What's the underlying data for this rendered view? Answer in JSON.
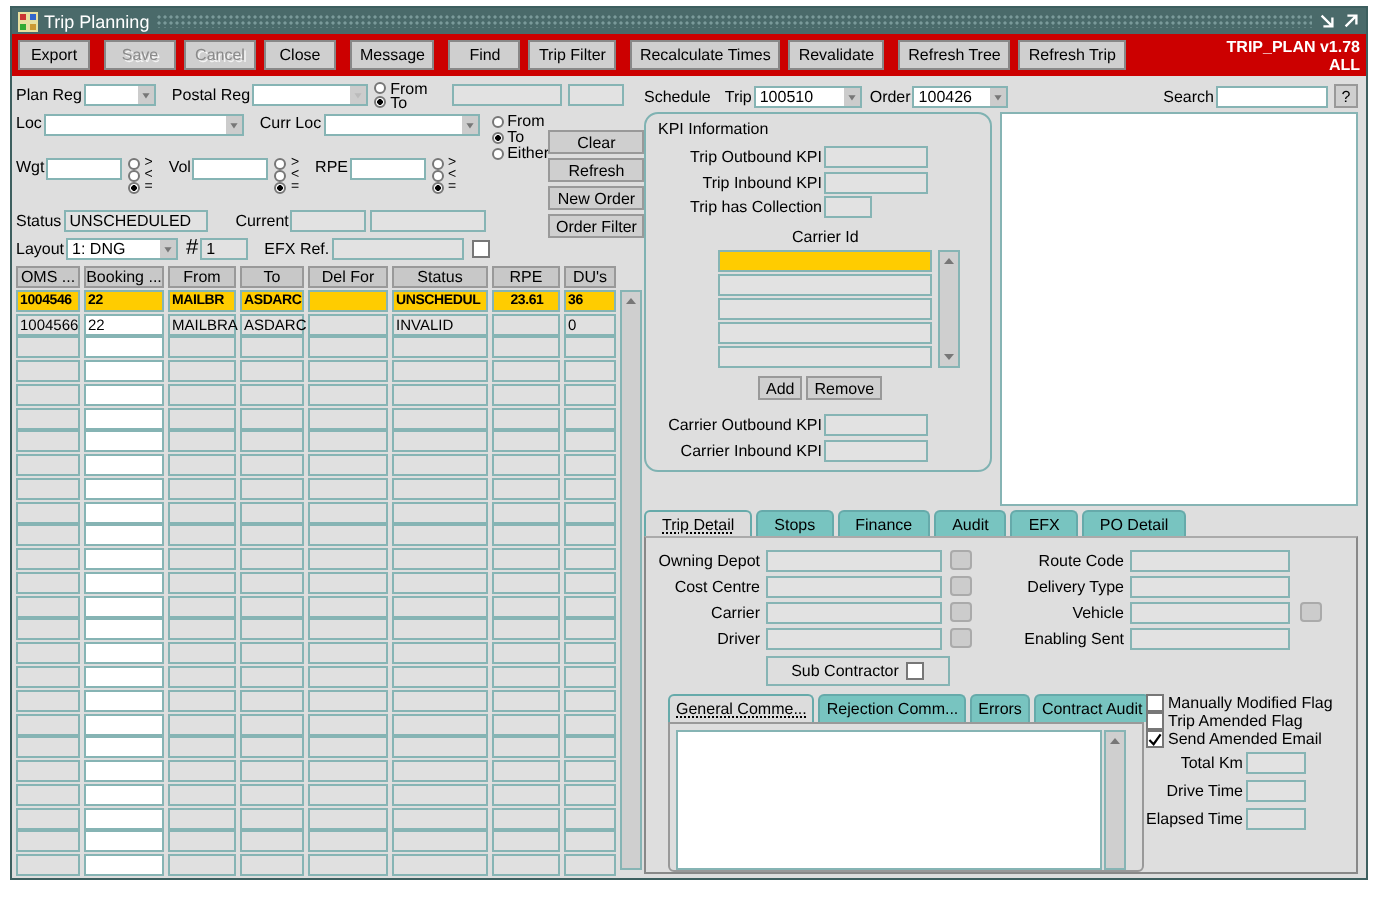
{
  "window": {
    "title": "Trip Planning",
    "version": "TRIP_PLAN v1.78",
    "mode": "ALL"
  },
  "toolbar": [
    {
      "label": "Export",
      "disabled": false
    },
    {
      "label": "Save",
      "disabled": true
    },
    {
      "label": "Cancel",
      "disabled": true
    },
    {
      "label": "Close",
      "disabled": false
    },
    {
      "label": "Message",
      "disabled": false
    },
    {
      "label": "Find",
      "disabled": false
    },
    {
      "label": "Trip Filter",
      "disabled": false
    },
    {
      "label": "Recalculate Times",
      "disabled": false
    },
    {
      "label": "Revalidate",
      "disabled": false
    },
    {
      "label": "Refresh Tree",
      "disabled": false
    },
    {
      "label": "Refresh Trip",
      "disabled": false
    }
  ],
  "filters": {
    "plan_reg": "Plan Reg",
    "postal_reg": "Postal Reg",
    "postal_direction": [
      {
        "label": "From",
        "selected": false
      },
      {
        "label": "To",
        "selected": true
      }
    ],
    "loc": "Loc",
    "curr_loc": "Curr Loc",
    "loc_direction": [
      {
        "label": "From",
        "selected": false
      },
      {
        "label": "To",
        "selected": true
      },
      {
        "label": "Either",
        "selected": false
      }
    ],
    "measures": [
      {
        "label": "Wgt",
        "compare": [
          {
            "label": ">",
            "selected": false
          },
          {
            "label": "<",
            "selected": false
          },
          {
            "label": "=",
            "selected": true
          }
        ]
      },
      {
        "label": "Vol",
        "compare": [
          {
            "label": ">",
            "selected": false
          },
          {
            "label": "<",
            "selected": false
          },
          {
            "label": "=",
            "selected": true
          }
        ]
      },
      {
        "label": "RPE",
        "compare": [
          {
            "label": ">",
            "selected": false
          },
          {
            "label": "<",
            "selected": false
          },
          {
            "label": "=",
            "selected": true
          }
        ]
      }
    ],
    "status": {
      "label": "Status",
      "value": "UNSCHEDULED"
    },
    "current": "Current",
    "layout": {
      "label": "Layout",
      "value": "1: DNG"
    },
    "number": {
      "label": "#",
      "value": "1"
    },
    "efx_ref": {
      "label": "EFX Ref.",
      "checked": false
    }
  },
  "side_buttons": [
    "Clear",
    "Refresh",
    "New Order",
    "Order Filter"
  ],
  "table": {
    "columns": [
      "OMS ...",
      "Booking ...",
      "From",
      "To",
      "Del For",
      "Status",
      "RPE",
      "DU's"
    ],
    "rows": [
      {
        "selected": true,
        "oms": "1004546",
        "booking": "22",
        "from": "MAILBR",
        "to": "ASDARC",
        "status": "UNSCHEDUL",
        "rpe": "23.61",
        "dus": "36"
      },
      {
        "selected": false,
        "oms": "1004566",
        "booking": "22",
        "from": "MAILBRA",
        "to": "ASDARC",
        "status": "INVALID",
        "dus": "0"
      }
    ]
  },
  "schedule": {
    "label": "Schedule",
    "trip": {
      "label": "Trip",
      "value": "100510"
    },
    "order": {
      "label": "Order",
      "value": "100426"
    },
    "search": "Search",
    "help": "?"
  },
  "kpi": {
    "title": "KPI Information",
    "trip_fields": [
      "Trip Outbound KPI",
      "Trip Inbound KPI",
      "Trip has Collection"
    ],
    "carrier_label": "Carrier Id",
    "carrier_rows": [
      {
        "selected": true
      },
      {
        "selected": false
      },
      {
        "selected": false
      },
      {
        "selected": false
      },
      {
        "selected": false
      }
    ],
    "buttons": [
      "Add",
      "Remove"
    ],
    "carrier_fields": [
      "Carrier Outbound KPI",
      "Carrier Inbound KPI"
    ]
  },
  "tabs": [
    {
      "label": "Trip Detail",
      "selected": true
    },
    {
      "label": "Stops",
      "selected": false
    },
    {
      "label": "Finance",
      "selected": false
    },
    {
      "label": "Audit",
      "selected": false
    },
    {
      "label": "EFX",
      "selected": false
    },
    {
      "label": "PO Detail",
      "selected": false
    }
  ],
  "detail": {
    "left": [
      {
        "label": "Owning Depot"
      },
      {
        "label": "Cost Centre"
      },
      {
        "label": "Carrier"
      },
      {
        "label": "Driver"
      }
    ],
    "right": [
      {
        "label": "Route Code"
      },
      {
        "label": "Delivery Type"
      },
      {
        "label": "Vehicle",
        "lookup": true
      },
      {
        "label": "Enabling Sent"
      }
    ],
    "sub_contractor": {
      "label": "Sub Contractor",
      "checked": false
    }
  },
  "comment_tabs": [
    {
      "label": "General Comme...",
      "selected": true
    },
    {
      "label": "Rejection Comm...",
      "selected": false
    },
    {
      "label": "Errors",
      "selected": false
    },
    {
      "label": "Contract Audit",
      "selected": false
    }
  ],
  "flags": [
    {
      "label": "Manually Modified Flag",
      "checked": false
    },
    {
      "label": "Trip Amended Flag",
      "checked": false
    },
    {
      "label": "Send Amended Email",
      "checked": true
    }
  ],
  "totals": [
    "Total Km",
    "Drive Time",
    "Elapsed Time"
  ]
}
